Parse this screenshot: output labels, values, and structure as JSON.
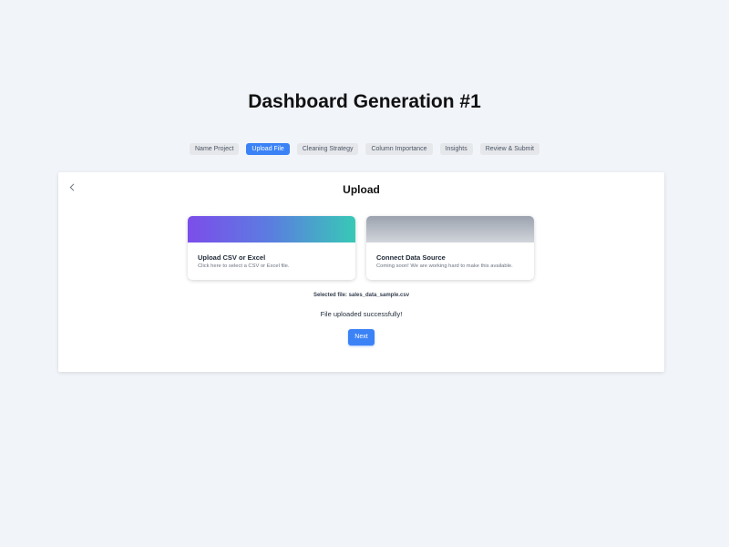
{
  "page": {
    "title": "Dashboard Generation #1"
  },
  "steps": [
    {
      "label": "Name Project",
      "active": false
    },
    {
      "label": "Upload File",
      "active": true
    },
    {
      "label": "Cleaning Strategy",
      "active": false
    },
    {
      "label": "Column Importance",
      "active": false
    },
    {
      "label": "Insights",
      "active": false
    },
    {
      "label": "Review & Submit",
      "active": false
    }
  ],
  "panel": {
    "back_icon": "chevron-left-icon",
    "title": "Upload",
    "cards": {
      "csv": {
        "title": "Upload CSV or Excel",
        "description": "Click here to select a CSV or Excel file."
      },
      "source": {
        "title": "Connect Data Source",
        "description": "Coming soon! We are working hard to make this available."
      }
    },
    "selected_file": "Selected file: sales_data_sample.csv",
    "status": "File uploaded successfully!",
    "next_label": "Next"
  },
  "colors": {
    "accent": "#3b82f6",
    "background": "#f1f4f9",
    "gradient_start": "#7c4dea",
    "gradient_end": "#38c9b6"
  }
}
